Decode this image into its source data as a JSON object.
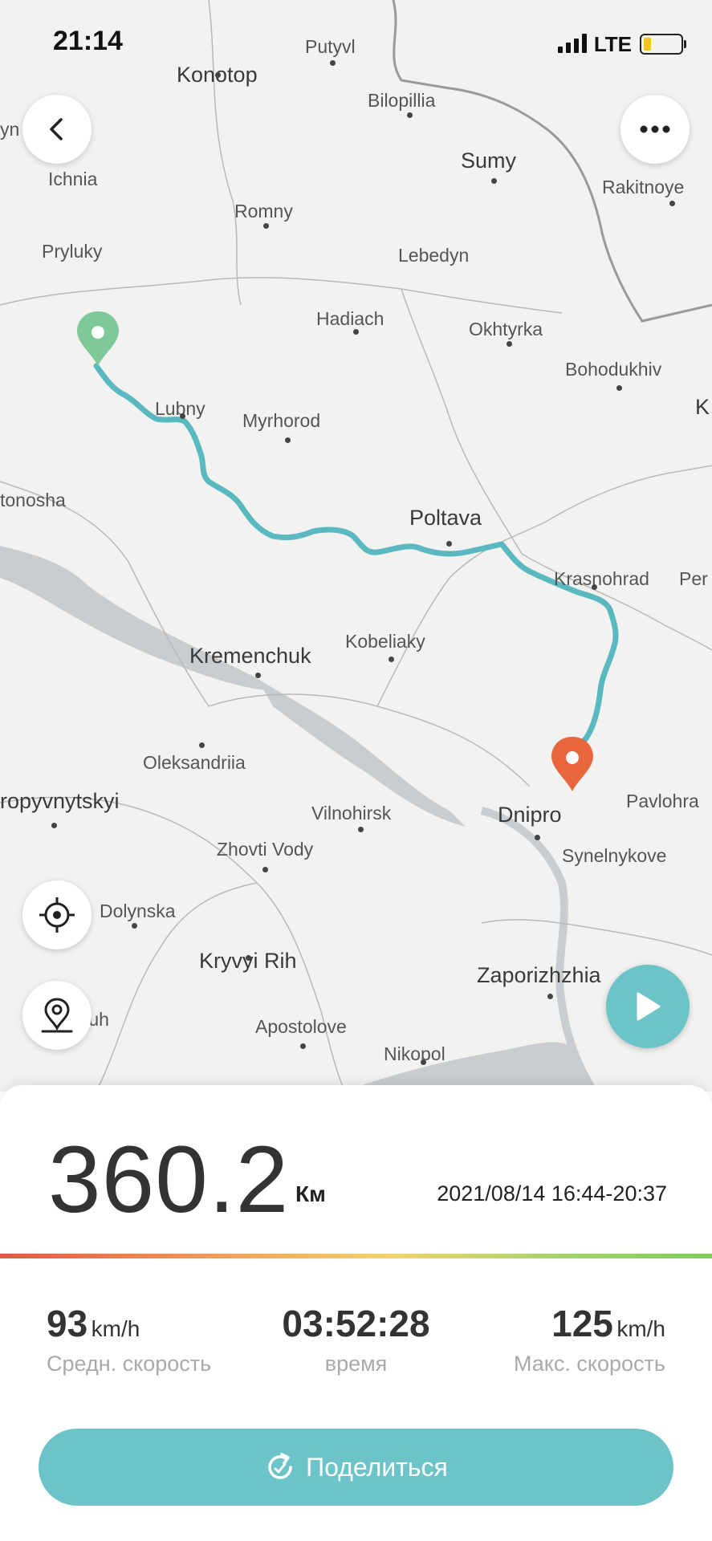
{
  "status_bar": {
    "time": "21:14",
    "network": "LTE",
    "battery_level": 0.2
  },
  "map": {
    "cities": [
      {
        "name": "Konotop"
      },
      {
        "name": "Putyvl"
      },
      {
        "name": "Bilopillia"
      },
      {
        "name": "Sumy"
      },
      {
        "name": "Rakitnoye"
      },
      {
        "name": "Ichnia"
      },
      {
        "name": "Romny"
      },
      {
        "name": "Pryluky"
      },
      {
        "name": "Lebedyn"
      },
      {
        "name": "Hadiach"
      },
      {
        "name": "Okhtyrka"
      },
      {
        "name": "Bohodukhiv"
      },
      {
        "name": "Lubny"
      },
      {
        "name": "Myrhorod"
      },
      {
        "name": "tonosha"
      },
      {
        "name": "Poltava"
      },
      {
        "name": "Krasnohrad"
      },
      {
        "name": "Per"
      },
      {
        "name": "Kobeliaky"
      },
      {
        "name": "Kremenchuk"
      },
      {
        "name": "Oleksandriia"
      },
      {
        "name": "ropyvnytskyi"
      },
      {
        "name": "Vilnohirsk"
      },
      {
        "name": "Dnipro"
      },
      {
        "name": "Pavlohra"
      },
      {
        "name": "Zhovti Vody"
      },
      {
        "name": "Synelnykove"
      },
      {
        "name": "Dolynska"
      },
      {
        "name": "Kryvyi Rih"
      },
      {
        "name": "Zaporizhzhia"
      },
      {
        "name": "yi Buh"
      },
      {
        "name": "Apostolove"
      },
      {
        "name": "Nikopol"
      },
      {
        "name": "yn"
      },
      {
        "name": "K"
      }
    ],
    "colors": {
      "route": "#5ab8c0",
      "start_pin": "#7ec99a",
      "end_pin": "#e8663d"
    }
  },
  "controls": {
    "back": "chevron-left-icon",
    "more": "more-icon",
    "locate": "crosshair-icon",
    "poi": "map-pin-icon",
    "play": "play-icon"
  },
  "summary": {
    "distance": "360.2",
    "distance_unit": "Км",
    "datetime": "2021/08/14 16:44-20:37"
  },
  "stats": {
    "avg_speed": {
      "value": "93",
      "unit": "km/h",
      "label": "Средн. скорость"
    },
    "duration": {
      "value": "03:52:28",
      "label": "время"
    },
    "max_speed": {
      "value": "125",
      "unit": "km/h",
      "label": "Макс. скорость"
    }
  },
  "share_button": {
    "label": "Поделиться"
  }
}
